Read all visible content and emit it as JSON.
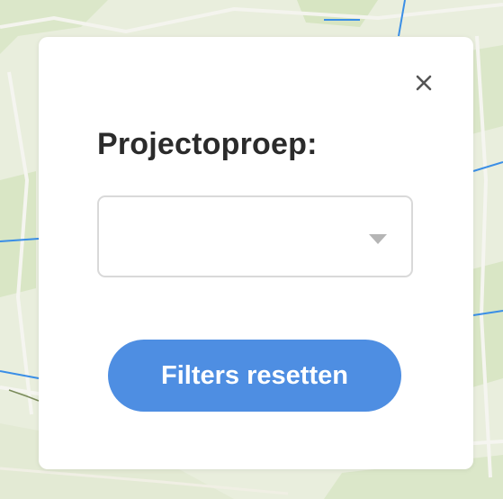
{
  "filter_modal": {
    "close_icon": "close-icon",
    "title": "Projectoproep:",
    "project_call_select": {
      "selected_value": "",
      "arrow_icon": "chevron-down-icon"
    },
    "reset_button_label": "Filters resetten"
  },
  "colors": {
    "accent": "#4e8ee2",
    "map_background": "#e8eddc",
    "map_water": "#3a8ee6"
  }
}
